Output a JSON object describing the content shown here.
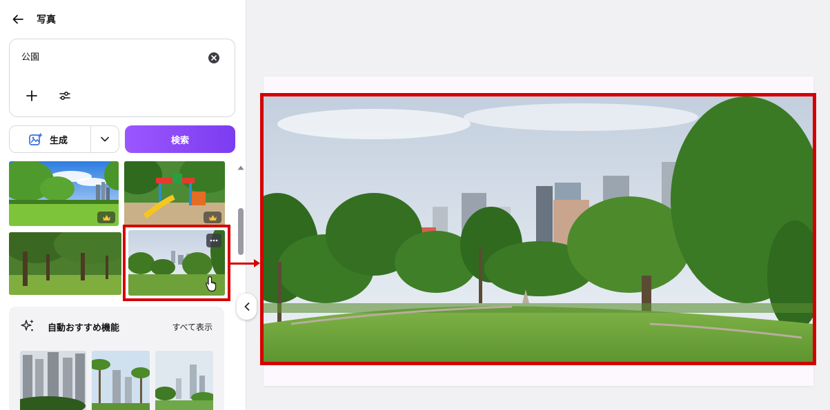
{
  "header": {
    "title": "写真",
    "back_icon": "arrow-left-icon"
  },
  "search": {
    "value": "公園",
    "clear_icon": "clear-icon",
    "add_icon": "plus-icon",
    "filter_icon": "filter-sliders-icon"
  },
  "actions": {
    "generate_label": "生成",
    "search_label": "検索",
    "generate_icon": "image-sparkle-icon",
    "dropdown_icon": "chevron-down-icon"
  },
  "results": [
    {
      "name": "park-lawn-city-skyline",
      "premium": true
    },
    {
      "name": "playground-slide",
      "premium": true
    },
    {
      "name": "park-trees-lawn",
      "premium": false
    },
    {
      "name": "park-lawn-city",
      "premium": false,
      "selected": true
    }
  ],
  "recommend": {
    "title": "自動おすすめ機能",
    "see_all": "すべて表示",
    "icon": "sparkle-icon"
  },
  "colors": {
    "accent": "#8b4af5",
    "highlight": "#d40000"
  }
}
